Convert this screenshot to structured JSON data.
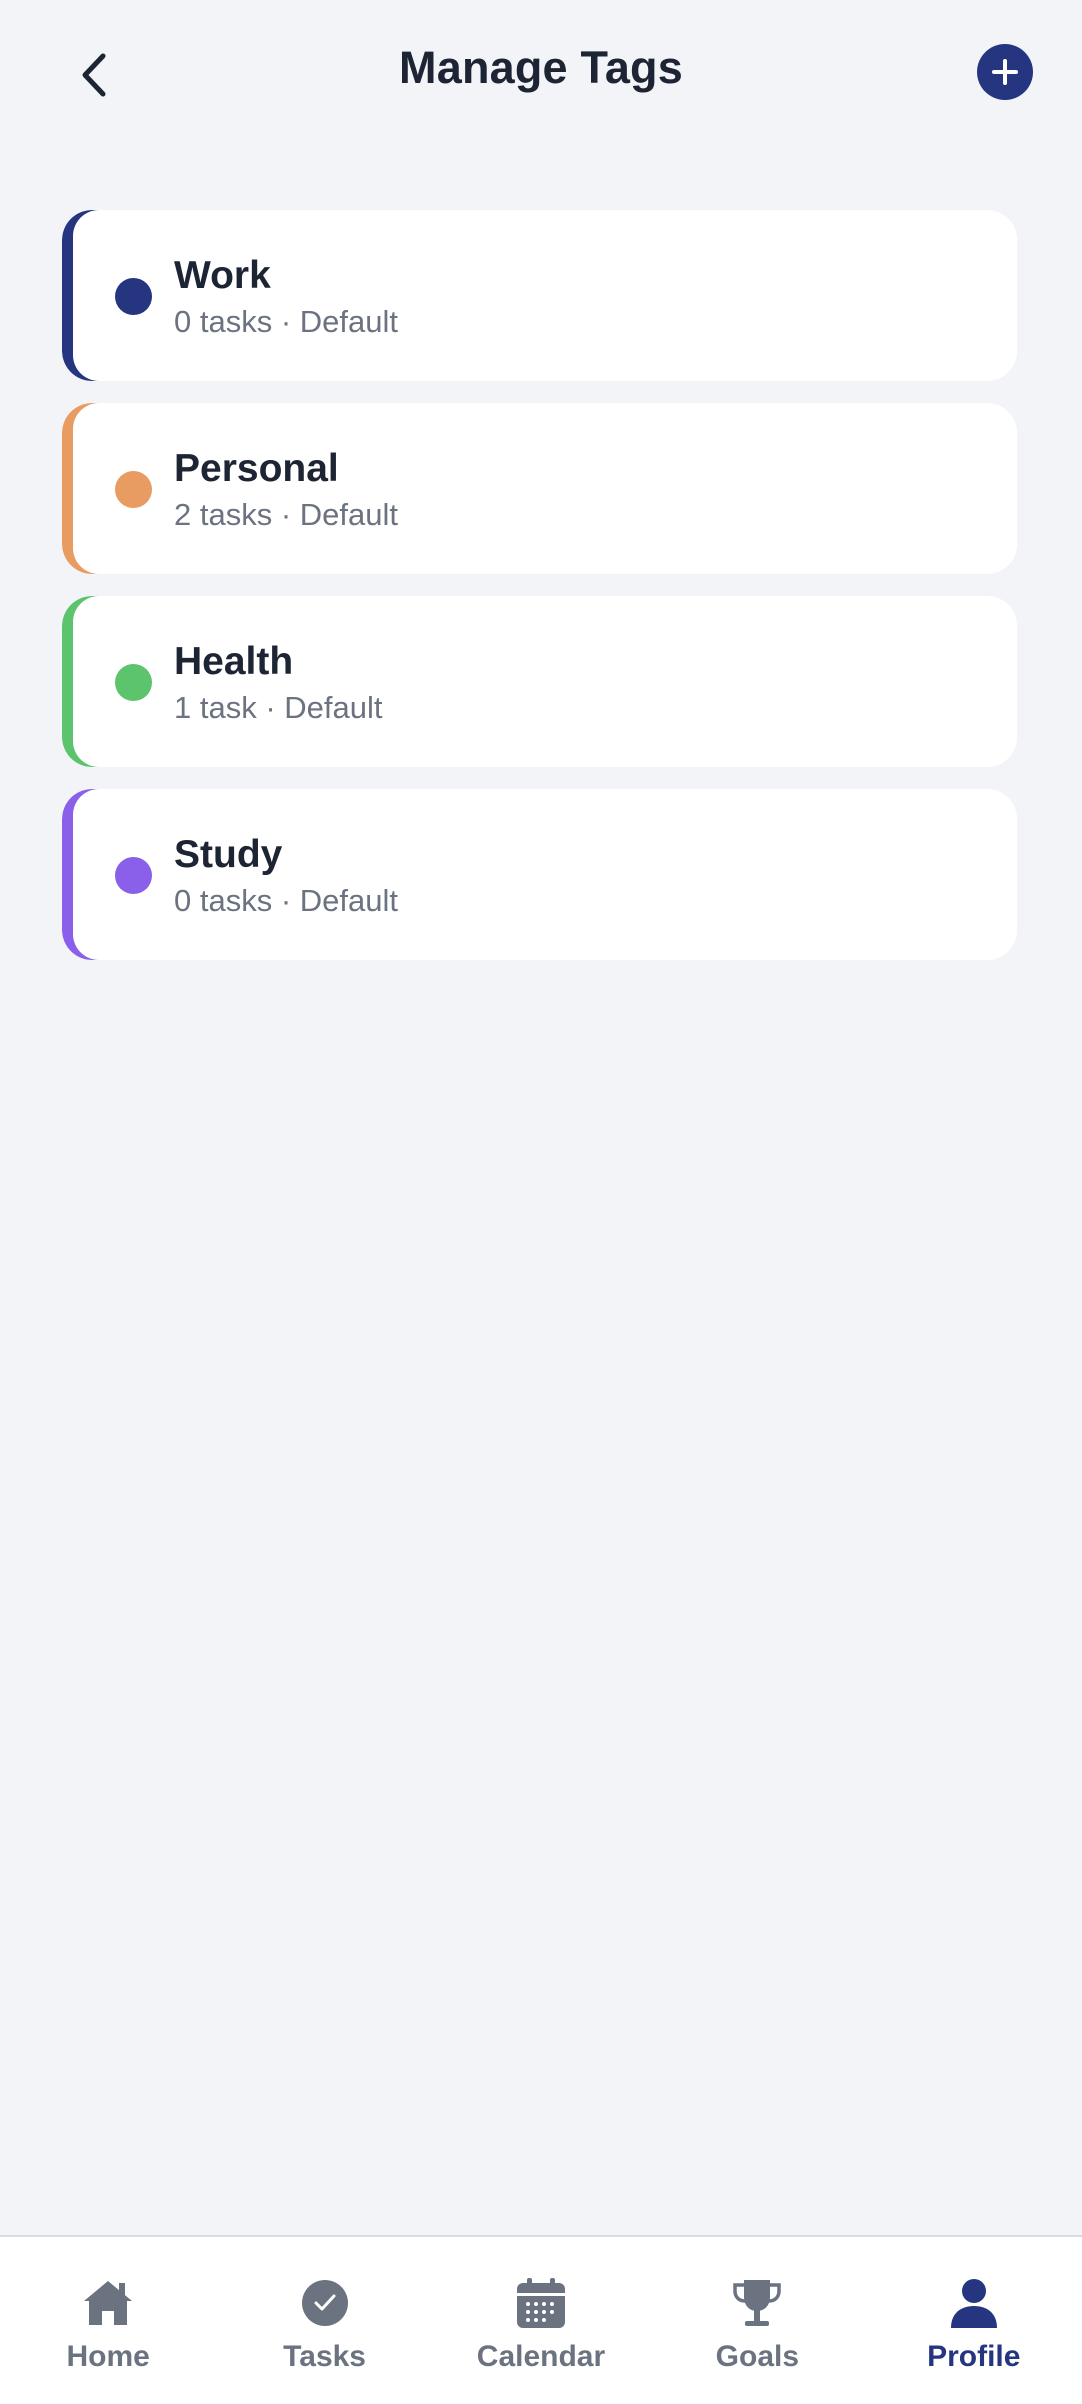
{
  "header": {
    "title": "Manage Tags",
    "back_icon": "chevron-left-icon",
    "add_icon": "plus-icon",
    "accent_color": "#253580"
  },
  "tags": [
    {
      "name": "Work",
      "meta": "0 tasks · Default",
      "color": "#253580"
    },
    {
      "name": "Personal",
      "meta": "2 tasks · Default",
      "color": "#e89c62"
    },
    {
      "name": "Health",
      "meta": "1 task · Default",
      "color": "#5cc46c"
    },
    {
      "name": "Study",
      "meta": "0 tasks · Default",
      "color": "#8a60ea"
    }
  ],
  "nav": {
    "items": [
      {
        "label": "Home",
        "icon": "home-icon"
      },
      {
        "label": "Tasks",
        "icon": "check-circle-icon"
      },
      {
        "label": "Calendar",
        "icon": "calendar-icon"
      },
      {
        "label": "Goals",
        "icon": "trophy-icon"
      },
      {
        "label": "Profile",
        "icon": "person-icon"
      }
    ],
    "active": "Profile",
    "active_color": "#253580",
    "inactive_color": "#6b7280"
  }
}
